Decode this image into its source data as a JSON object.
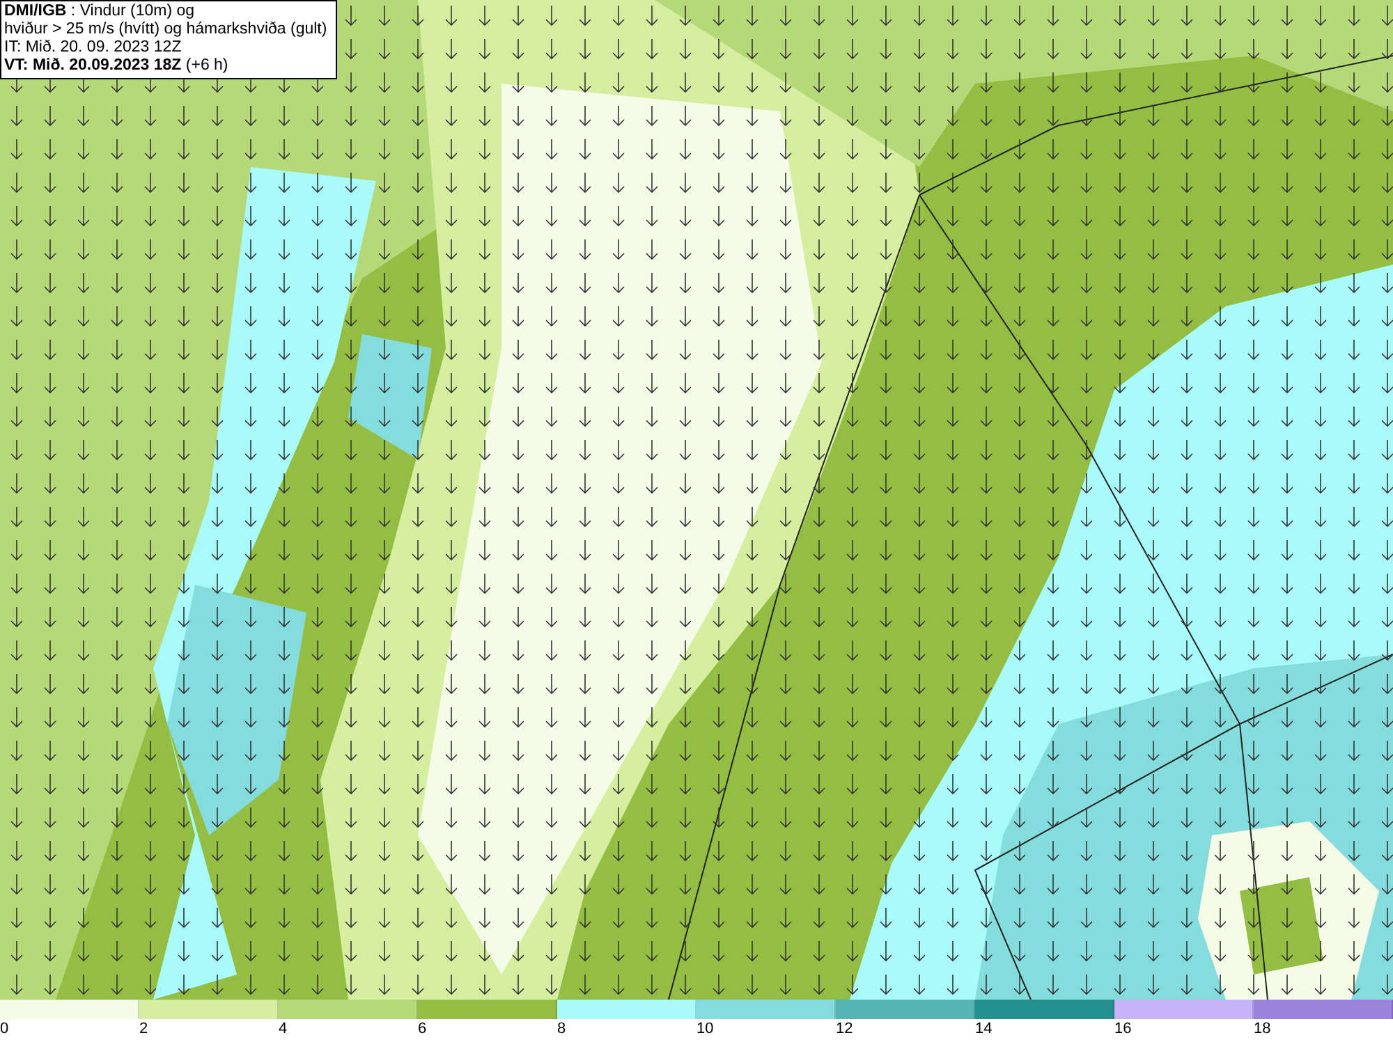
{
  "info_box": {
    "lines": [
      "**DMI/IGB** : Vindur (10m) og",
      "hviður > 25 m/s (hvítt) og hámarkshviða (gult)",
      "IT: Mið. 20. 09. 2023 12Z",
      "**VT: Mið. 20.09.2023 18Z** (+6 h)"
    ]
  },
  "legend": {
    "bins": [
      {
        "color": "#f4fbe6",
        "label": "0"
      },
      {
        "color": "#d6eea0",
        "label": "2"
      },
      {
        "color": "#b5d878",
        "label": "4"
      },
      {
        "color": "#94bd44",
        "label": "6"
      },
      {
        "color": "#a9fbfb",
        "label": "8"
      },
      {
        "color": "#85dcdc",
        "label": "10"
      },
      {
        "color": "#55b5b5",
        "label": "12"
      },
      {
        "color": "#238f8f",
        "label": "14"
      },
      {
        "color": "#c5b5f8",
        "label": "16"
      },
      {
        "color": "#9b82dc",
        "label": "18"
      }
    ]
  }
}
